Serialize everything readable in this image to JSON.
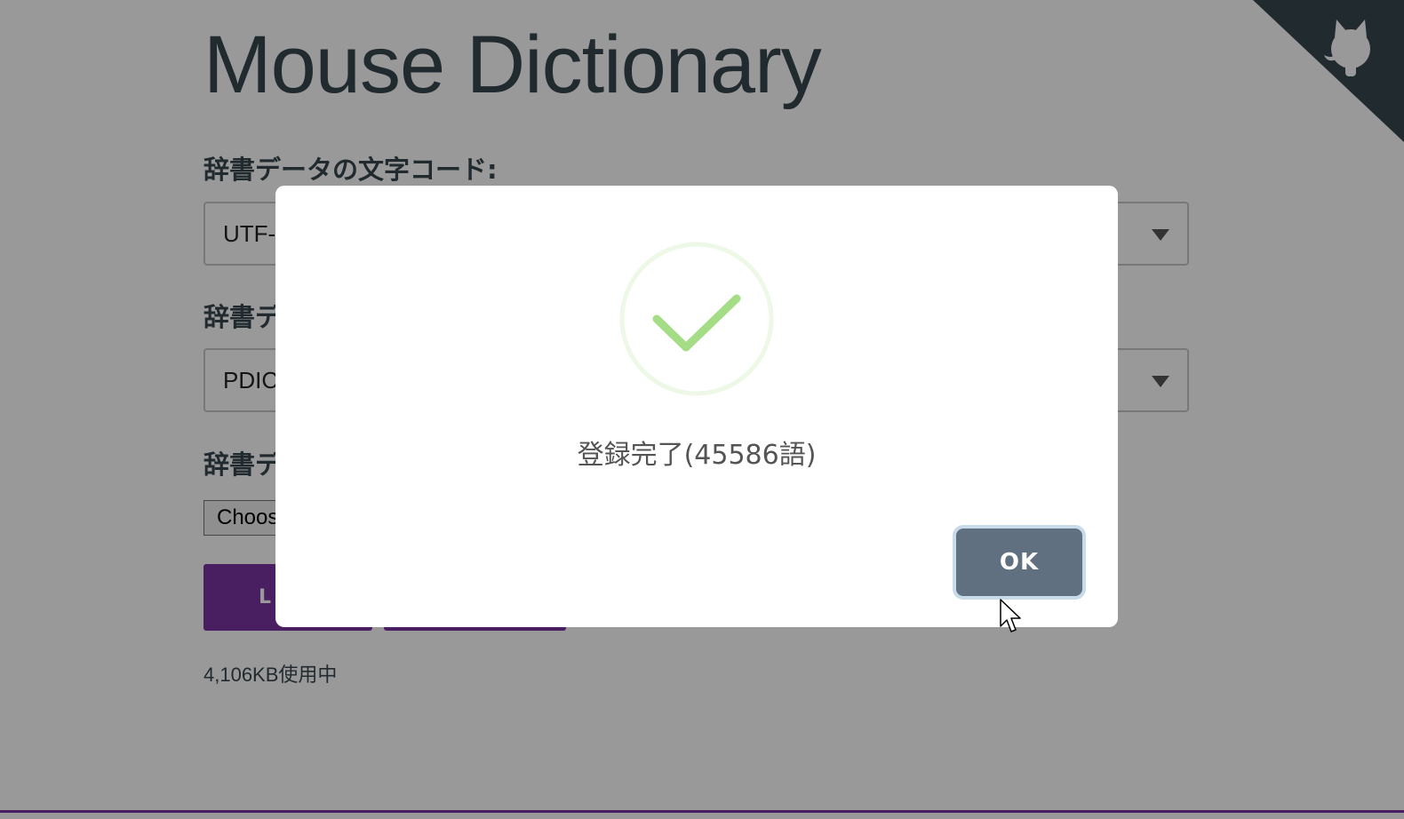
{
  "app": {
    "title": "Mouse Dictionary"
  },
  "settings": {
    "encoding_label": "辞書データの文字コード:",
    "encoding_value": "UTF-",
    "format_label": "辞書デ",
    "format_value": "PDIC",
    "file_label": "辞書デ",
    "file_button": "Choos",
    "load_button": "L",
    "usage": "4,106KB使用中"
  },
  "dialog": {
    "message": "登録完了(45586語)",
    "ok_label": "OK",
    "icon": "success-check-icon"
  },
  "colors": {
    "accent": "#7b35a3",
    "success": "#a5dc86",
    "ok_button": "#607080",
    "text": "#37474f"
  }
}
